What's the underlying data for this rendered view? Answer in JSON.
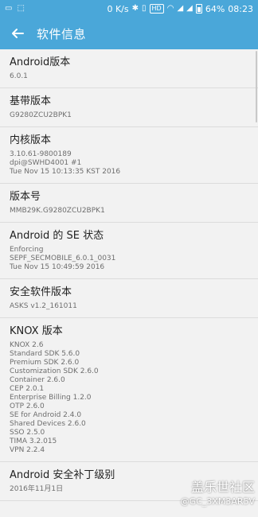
{
  "status_bar": {
    "speed": "0 K/s",
    "hd": "HD",
    "battery": "64%",
    "time": "08:23",
    "icons": [
      "bluetooth-icon",
      "vibrate-icon",
      "wifi-icon",
      "signal-icon",
      "battery-icon"
    ]
  },
  "toolbar": {
    "title": "软件信息"
  },
  "items": [
    {
      "title": "Android版本",
      "lines": [
        "6.0.1"
      ]
    },
    {
      "title": "基带版本",
      "lines": [
        "G9280ZCU2BPK1"
      ]
    },
    {
      "title": "内核版本",
      "lines": [
        "3.10.61-9800189",
        "dpi@SWHD4001 #1",
        "Tue Nov 15 10:13:35 KST 2016"
      ]
    },
    {
      "title": "版本号",
      "lines": [
        "MMB29K.G9280ZCU2BPK1"
      ]
    },
    {
      "title": "Android 的 SE 状态",
      "lines": [
        "Enforcing",
        "SEPF_SECMOBILE_6.0.1_0031",
        "Tue Nov 15 10:49:59 2016"
      ]
    },
    {
      "title": "安全软件版本",
      "lines": [
        "ASKS v1.2_161011"
      ]
    },
    {
      "title": "KNOX 版本",
      "lines": [
        "KNOX 2.6",
        "Standard SDK 5.6.0",
        "Premium SDK 2.6.0",
        "Customization SDK 2.6.0",
        "Container 2.6.0",
        "CEP 2.0.1",
        "Enterprise Billing 1.2.0",
        "OTP 2.6.0",
        "SE for Android 2.4.0",
        "Shared Devices 2.6.0",
        "SSO 2.5.0",
        "TIMA 3.2.015",
        "VPN 2.2.4"
      ]
    },
    {
      "title": "Android 安全补丁级别",
      "lines": [
        "2016年11月1日"
      ]
    }
  ],
  "watermark": {
    "site": "盖乐世社区",
    "user": "@GC_3XM3AR5V"
  }
}
